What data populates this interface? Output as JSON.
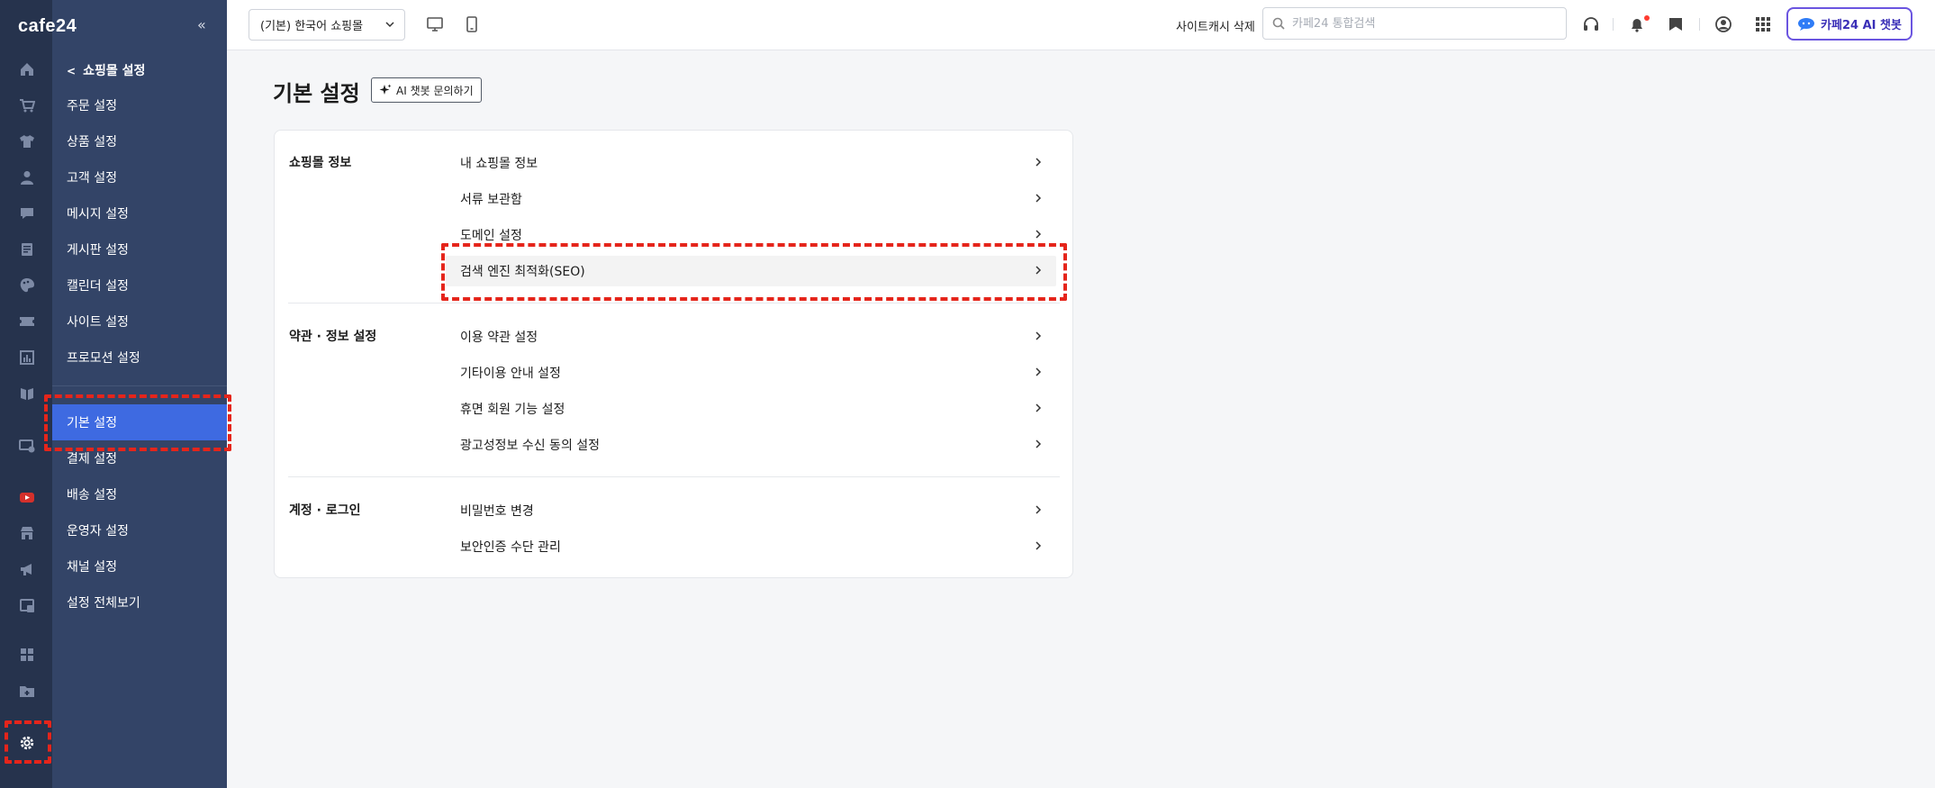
{
  "app": {
    "logo": "cafe24"
  },
  "rail": {
    "icons": [
      "home-icon",
      "cart-icon",
      "shirt-icon",
      "user-icon",
      "chat-icon",
      "board-icon",
      "palette-icon",
      "ticket-icon",
      "chart-icon",
      "book-icon",
      "video-settings-icon",
      "youtube-icon",
      "store-icon",
      "megaphone-icon",
      "channel-icon",
      "apps-icon",
      "folder-icon",
      "settings-icon"
    ]
  },
  "submenu": {
    "collapse_symbol": "«",
    "back_label": "쇼핑몰 설정",
    "items": [
      {
        "label": "주문 설정"
      },
      {
        "label": "상품 설정"
      },
      {
        "label": "고객 설정"
      },
      {
        "label": "메시지 설정"
      },
      {
        "label": "게시판 설정"
      },
      {
        "label": "캘린더 설정"
      },
      {
        "label": "사이트 설정"
      },
      {
        "label": "프로모션 설정"
      }
    ],
    "items2": [
      {
        "label": "기본 설정",
        "active": true
      },
      {
        "label": "결제 설정"
      },
      {
        "label": "배송 설정"
      },
      {
        "label": "운영자 설정"
      },
      {
        "label": "채널 설정"
      },
      {
        "label": "설정 전체보기"
      }
    ]
  },
  "topbar": {
    "shop_select_value": "(기본) 한국어 쇼핑몰",
    "cache_delete_label": "사이트캐시 삭제",
    "search_placeholder": "카페24 통합검색",
    "ai_chat_label": "카페24 AI 챗봇"
  },
  "page": {
    "title": "기본 설정",
    "ai_inquiry_label": "AI 챗봇 문의하기"
  },
  "sections": [
    {
      "title": "쇼핑몰 정보",
      "items": [
        "내 쇼핑몰 정보",
        "서류 보관함",
        "도메인 설정",
        "검색 엔진 최적화(SEO)"
      ]
    },
    {
      "title": "약관 · 정보 설정",
      "items": [
        "이용 약관 설정",
        "기타이용 안내 설정",
        "휴면 회원 기능 설정",
        "광고성정보 수신 동의 설정"
      ]
    },
    {
      "title": "계정 · 로그인",
      "items": [
        "비밀번호 변경",
        "보안인증 수단 관리"
      ]
    }
  ],
  "colors": {
    "rail_bg": "#26334d",
    "submenu_bg": "#334467",
    "active_item": "#3e6ae1",
    "annotation_red": "#e5251b",
    "ai_button_border": "#6b55e0"
  }
}
